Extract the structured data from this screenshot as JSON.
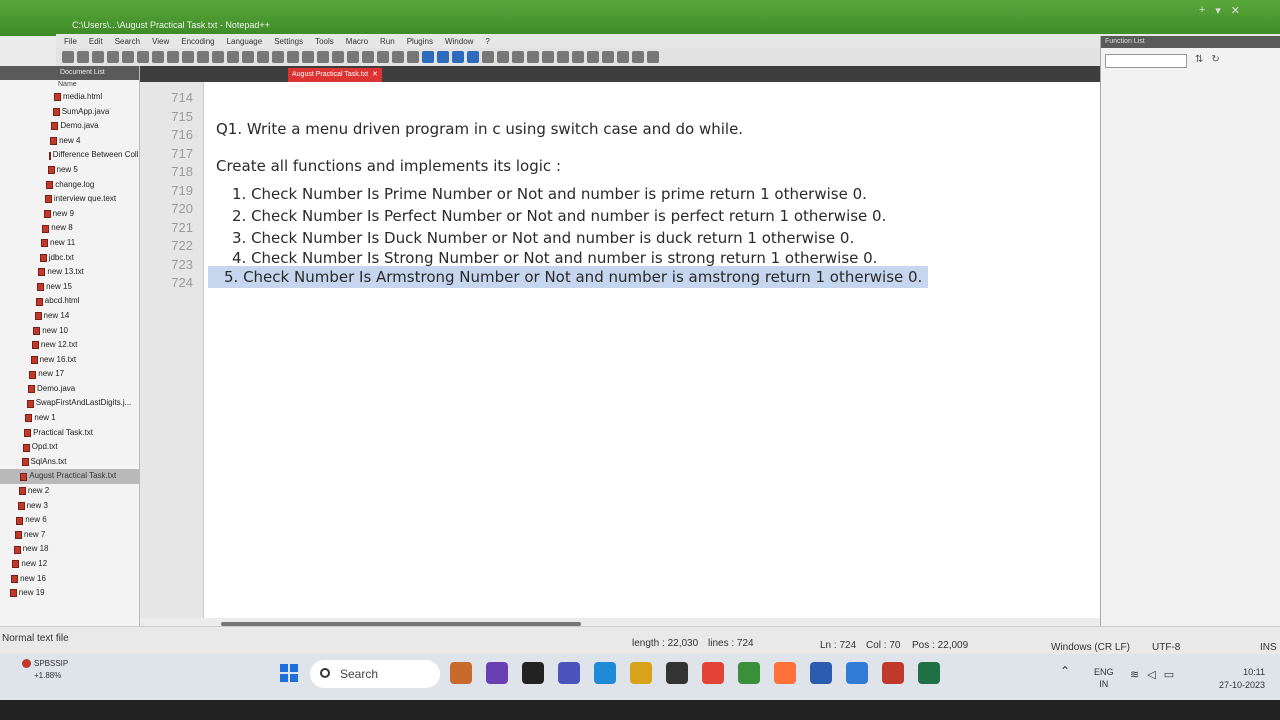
{
  "window": {
    "title": "C:\\Users\\...\\August Practical Task.txt - Notepad++",
    "controls": [
      "+",
      "▾",
      "✕"
    ]
  },
  "menu": [
    "File",
    "Edit",
    "Search",
    "View",
    "Encoding",
    "Language",
    "Settings",
    "Tools",
    "Macro",
    "Run",
    "Plugins",
    "Window",
    "?"
  ],
  "project": {
    "header": "Document List",
    "column": "Name",
    "files": [
      "media.html",
      "SumApp.java",
      "Demo.java",
      "new 4",
      "Difference Between Coll...",
      "new 5",
      "change.log",
      "interview que.text",
      "new 9",
      "new 8",
      "new 11",
      "jdbc.txt",
      "new 13.txt",
      "new 15",
      "abcd.html",
      "new 14",
      "new 10",
      "new 12.txt",
      "new 16.txt",
      "new 17",
      "Demo.java",
      "SwapFirstAndLastDigits.j...",
      "new 1",
      "Practical Task.txt",
      "Opd.txt",
      "SqlAns.txt",
      "August Practical Task.txt",
      "new 2",
      "new 3",
      "new 6",
      "new 7",
      "new 18",
      "new 12",
      "new 16",
      "new 19"
    ],
    "active_index": 26
  },
  "tab": {
    "label": "August Practical Task.txt",
    "close": "✕"
  },
  "editor": {
    "line_numbers": [
      "714",
      "715",
      "716",
      "717",
      "718",
      "719",
      "720",
      "721",
      "722",
      "723",
      "724"
    ],
    "lines": {
      "q1": "Q1. Write a menu driven program in c using switch case and do while.",
      "intro": "Create all functions and implements its logic :",
      "i1": "1.  Check Number Is Prime Number or Not and number is prime return 1 otherwise 0.",
      "i2": "2. Check Number Is Perfect Number or Not and number is perfect return 1 otherwise 0.",
      "i3": "3. Check Number Is Duck Number or Not and number is duck return 1 otherwise 0.",
      "i4": "4. Check Number Is Strong Number or Not and number is strong return 1 otherwise 0.",
      "i5": "5. Check Number Is Armstrong Number or Not and number is amstrong return 1 otherwise 0."
    }
  },
  "function_list": {
    "header": "Function List",
    "icons": [
      "sort-icon",
      "refresh-icon"
    ]
  },
  "status": {
    "type": "Normal text file",
    "length": "length : 22,030",
    "lines": "lines : 724",
    "ln": "Ln : 724",
    "col": "Col : 70",
    "pos": "Pos : 22,009",
    "eol": "Windows (CR LF)",
    "enc": "UTF-8",
    "mode": "INS"
  },
  "taskbar": {
    "weather_title": "SPBSSIP",
    "weather_value": "+1.88%",
    "search": "Search",
    "lang_top": "ENG",
    "lang_bottom": "IN",
    "time": "10:11",
    "date": "27-10-2023",
    "app_colors": [
      "#c86a2c",
      "#6a3fb3",
      "#222222",
      "#4b53bc",
      "#1f8ad6",
      "#d9a21b",
      "#333333",
      "#e34234",
      "#3a8f3a",
      "#ff7139",
      "#2a5db0",
      "#2f7bd6",
      "#c0392b",
      "#1e7145"
    ]
  }
}
